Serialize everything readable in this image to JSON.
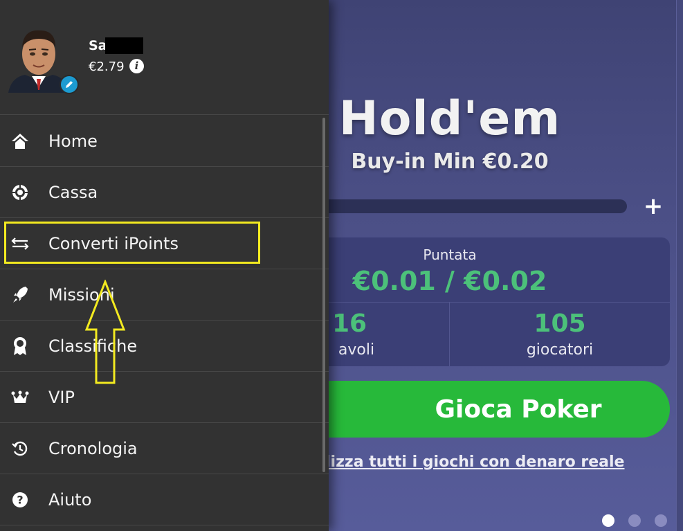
{
  "user": {
    "name": "Sa",
    "balance": "€2.79"
  },
  "menu": {
    "items": [
      {
        "label": "Home",
        "icon": "home-icon"
      },
      {
        "label": "Cassa",
        "icon": "chip-icon"
      },
      {
        "label": "Converti iPoints",
        "icon": "swap-arrows-icon"
      },
      {
        "label": "Missioni",
        "icon": "rocket-icon"
      },
      {
        "label": "Classifiche",
        "icon": "medal-icon"
      },
      {
        "label": "VIP",
        "icon": "crown-icon"
      },
      {
        "label": "Cronologia",
        "icon": "history-icon"
      },
      {
        "label": "Aiuto",
        "icon": "help-icon"
      }
    ]
  },
  "game": {
    "title": "Hold'em",
    "buyin": "Buy-in Min €0.20",
    "stake_label": "Puntata",
    "stake_value": "€0.01 / €0.02",
    "tables_count": "16",
    "tables_label": "avoli",
    "players_count": "105",
    "players_label": "giocatori",
    "play_button": "Gioca Poker",
    "real_money_link": "lizza tutti i giochi con denaro reale"
  },
  "carousel": {
    "pages": 3,
    "active": 1
  },
  "colors": {
    "drawer_bg": "#323232",
    "accent_green": "#27b93a",
    "value_green": "#4cc17a",
    "highlight_yellow": "#f3ea20",
    "edit_badge_blue": "#1c9bd1"
  }
}
